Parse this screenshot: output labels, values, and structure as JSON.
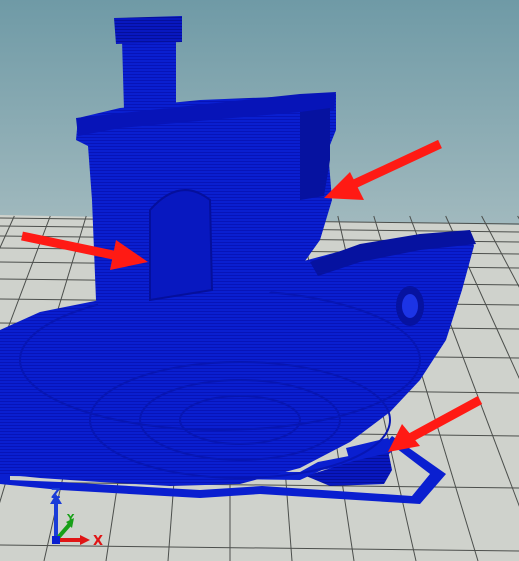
{
  "viewport": {
    "background_top": "#6f9aa6",
    "background_bottom": "#c9d6d6",
    "floor_color": "#cfd2cc",
    "grid_color": "#4c4f4c",
    "model_color": "#0a1fd0",
    "model_dark": "#0612a0",
    "arrow_color": "#ff1a14"
  },
  "axes": {
    "x_label": "X",
    "y_label": "Y",
    "z_label": "Z",
    "x_color": "#e01515",
    "y_color": "#18a018",
    "z_color": "#1a3cd8"
  },
  "annotations": [
    {
      "label": "arrow-cabin-rear"
    },
    {
      "label": "arrow-cabin-window"
    },
    {
      "label": "arrow-stern-skirt"
    }
  ]
}
